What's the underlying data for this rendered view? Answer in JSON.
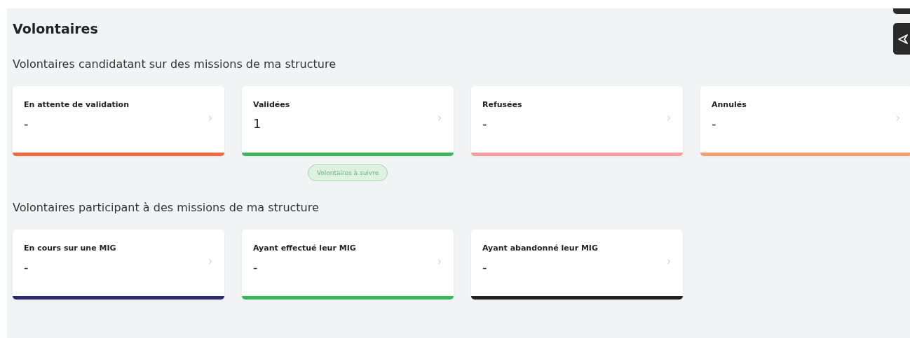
{
  "title": "Volontaires",
  "sections": [
    {
      "heading": "Volontaires candidatant sur des missions de ma structure",
      "cards": [
        {
          "label": "En attente de validation",
          "value": "-",
          "color": "#f0683f"
        },
        {
          "label": "Validées",
          "value": "1",
          "color": "#3cb55e",
          "follow_button": {
            "label": "Volontaires à suivre"
          }
        },
        {
          "label": "Refusées",
          "value": "-",
          "color": "#f4a0a0"
        },
        {
          "label": "Annulés",
          "value": "-",
          "color": "#f6a070"
        }
      ]
    },
    {
      "heading": "Volontaires participant à des missions de ma structure",
      "cards": [
        {
          "label": "En cours sur une MIG",
          "value": "-",
          "color": "#2e2a6e"
        },
        {
          "label": "Ayant effectué leur MIG",
          "value": "-",
          "color": "#3cb55e"
        },
        {
          "label": "Ayant abandonné leur MIG",
          "value": "-",
          "color": "#222222"
        }
      ]
    }
  ]
}
